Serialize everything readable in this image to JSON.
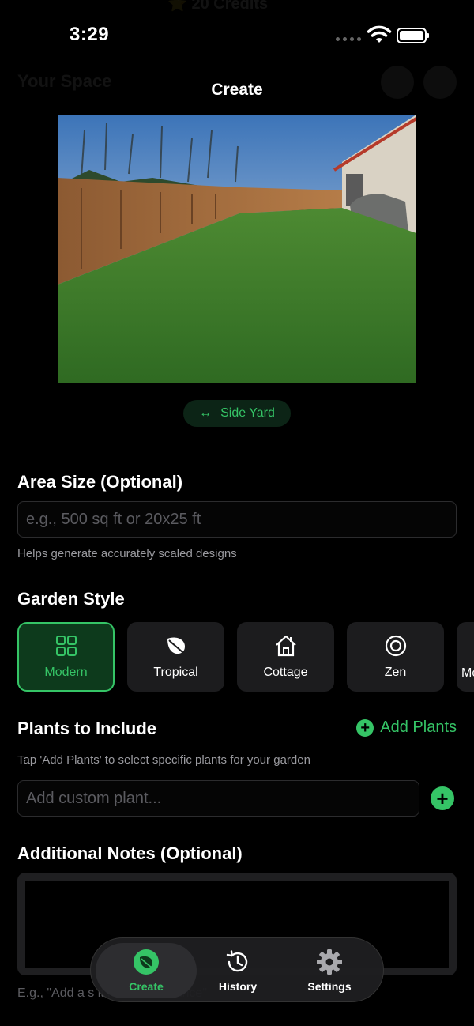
{
  "status": {
    "time": "3:29"
  },
  "sheet": {
    "title": "Create"
  },
  "location_chip": {
    "label": "Side Yard",
    "icon": "horizontal-arrows-icon"
  },
  "area": {
    "title": "Area Size (Optional)",
    "placeholder": "e.g., 500 sq ft or 20x25 ft",
    "helper": "Helps generate accurately scaled designs"
  },
  "garden_style": {
    "title": "Garden Style",
    "options": [
      {
        "label": "Modern",
        "icon": "grid-icon",
        "selected": true
      },
      {
        "label": "Tropical",
        "icon": "leaf-icon",
        "selected": false
      },
      {
        "label": "Cottage",
        "icon": "house-icon",
        "selected": false
      },
      {
        "label": "Zen",
        "icon": "target-icon",
        "selected": false
      },
      {
        "label": "Me",
        "icon": "",
        "selected": false
      }
    ]
  },
  "plants": {
    "title": "Plants to Include",
    "add_label": "Add Plants",
    "helper": "Tap 'Add Plants' to select specific plants for your garden",
    "custom_placeholder": "Add custom plant..."
  },
  "notes": {
    "title": "Additional Notes (Optional)",
    "hint": "E.g., \"Add a s                                                              it low maintenance\""
  },
  "tabbar": {
    "tabs": [
      {
        "label": "Create",
        "icon": "leaf-circle-icon",
        "active": true
      },
      {
        "label": "History",
        "icon": "clock-history-icon",
        "active": false
      },
      {
        "label": "Settings",
        "icon": "gear-icon",
        "active": false
      }
    ]
  },
  "colors": {
    "accent": "#35c466",
    "background": "#000000",
    "card": "#1c1c1e"
  }
}
